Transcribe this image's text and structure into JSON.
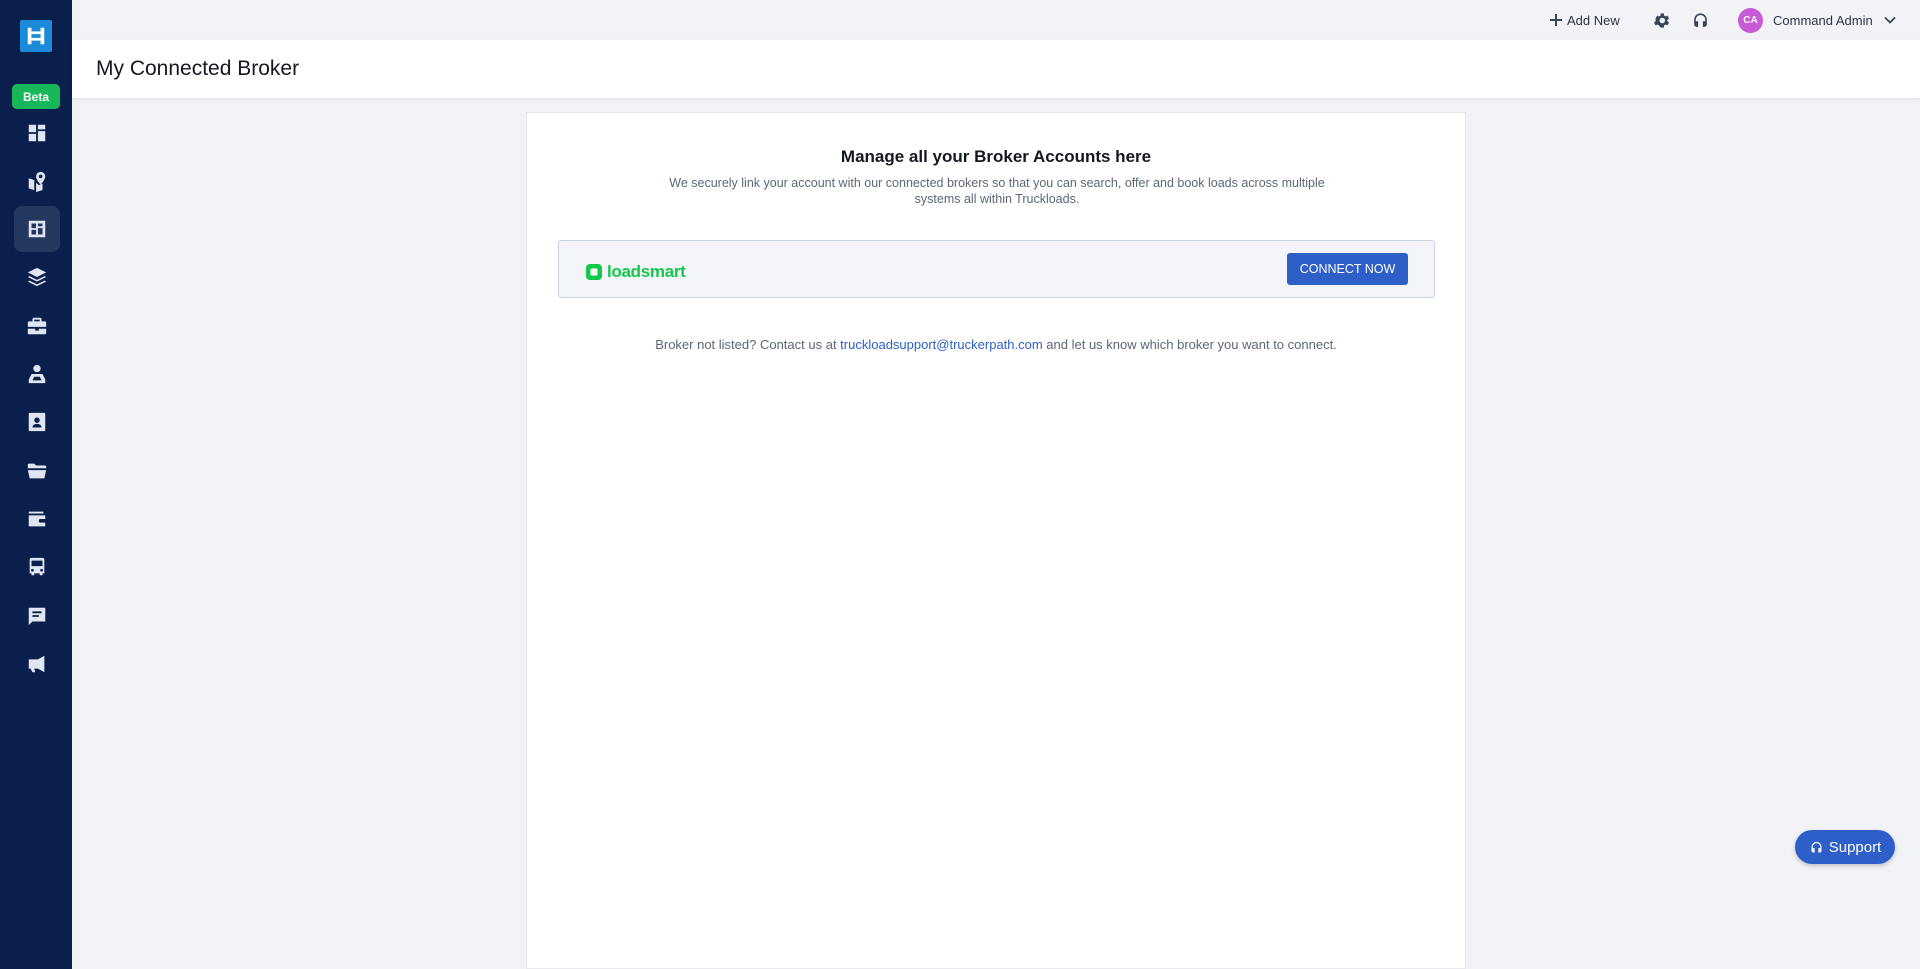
{
  "sidebar": {
    "beta_label": "Beta",
    "items": [
      {
        "icon": "dashboard-icon"
      },
      {
        "icon": "map-pin-icon"
      },
      {
        "icon": "broker-icon",
        "active": true
      },
      {
        "icon": "layers-icon"
      },
      {
        "icon": "briefcase-icon"
      },
      {
        "icon": "driver-icon"
      },
      {
        "icon": "contact-card-icon"
      },
      {
        "icon": "folder-icon"
      },
      {
        "icon": "wallet-icon"
      },
      {
        "icon": "truck-icon"
      },
      {
        "icon": "message-icon"
      },
      {
        "icon": "megaphone-icon"
      }
    ]
  },
  "topbar": {
    "add_new_label": "Add New",
    "user_initials": "CA",
    "user_name": "Command Admin"
  },
  "page": {
    "title": "My Connected Broker"
  },
  "main": {
    "heading": "Manage all your Broker Accounts here",
    "description": "We securely link your account with our connected brokers so that you can search, offer and book loads across multiple systems all within Truckloads.",
    "brokers": [
      {
        "name": "loadsmart",
        "button_label": "CONNECT NOW"
      }
    ],
    "footer_prefix": "Broker not listed? Contact us at ",
    "footer_email": "truckloadsupport@truckerpath.com",
    "footer_suffix": " and let us know which broker you want to connect."
  },
  "support": {
    "label": "Support"
  },
  "colors": {
    "sidebar_bg": "#0b1f4d",
    "accent": "#2e5fc9",
    "beta": "#18b85a",
    "loadsmart_green": "#14c84a",
    "avatar": "#c85ad6"
  }
}
